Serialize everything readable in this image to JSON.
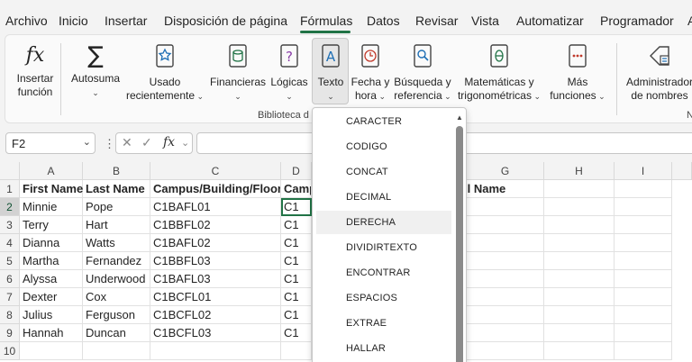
{
  "menu": {
    "tabs": [
      "Archivo",
      "Inicio",
      "Insertar",
      "Disposición de página",
      "Fórmulas",
      "Datos",
      "Revisar",
      "Vista",
      "Automatizar",
      "Programador",
      "A"
    ],
    "active_tab": "Fórmulas",
    "accent_color": "#217346"
  },
  "ribbon": {
    "insertar_funcion": [
      "Insertar",
      "función"
    ],
    "autosuma": "Autosuma",
    "usado_recientemente": [
      "Usado",
      "recientemente"
    ],
    "financieras": "Financieras",
    "logicas": "Lógicas",
    "texto": "Texto",
    "fecha_hora": [
      "Fecha y",
      "hora"
    ],
    "busqueda": [
      "Búsqueda y",
      "referencia"
    ],
    "matematicas": [
      "Matemáticas y",
      "trigonométricas"
    ],
    "mas_funciones": [
      "Más",
      "funciones"
    ],
    "administrador": [
      "Administrador",
      "de nombres"
    ],
    "group_label": "Biblioteca d",
    "right_cut": "N"
  },
  "formula_bar": {
    "name_box": "F2",
    "fx": "fx",
    "formula": ""
  },
  "grid": {
    "columns": [
      "A",
      "B",
      "C",
      "D",
      "E",
      "F",
      "G",
      "H",
      "I"
    ],
    "rows": [
      "1",
      "2",
      "3",
      "4",
      "5",
      "6",
      "7",
      "8",
      "9",
      "10"
    ],
    "header_row": [
      "First Name",
      "Last Name",
      "Campus/Building/Floor",
      "Camp",
      "",
      "ll Name"
    ],
    "data": [
      [
        "Minnie",
        "Pope",
        "C1BAFL01",
        "C1"
      ],
      [
        "Terry",
        "Hart",
        "C1BBFL02",
        "C1"
      ],
      [
        "Dianna",
        "Watts",
        "C1BAFL02",
        "C1"
      ],
      [
        "Martha",
        "Fernandez",
        "C1BBFL03",
        "C1"
      ],
      [
        "Alyssa",
        "Underwood",
        "C1BAFL03",
        "C1"
      ],
      [
        "Dexter",
        "Cox",
        "C1BCFL01",
        "C1"
      ],
      [
        "Julius",
        "Ferguson",
        "C1BCFL02",
        "C1"
      ],
      [
        "Hannah",
        "Duncan",
        "C1BCFL03",
        "C1"
      ]
    ]
  },
  "dropdown": {
    "items": [
      "CARACTER",
      "CODIGO",
      "CONCAT",
      "DECIMAL",
      "DERECHA",
      "DIVIDIRTEXTO",
      "ENCONTRAR",
      "ESPACIOS",
      "EXTRAE",
      "HALLAR"
    ],
    "hovered": "DERECHA"
  }
}
